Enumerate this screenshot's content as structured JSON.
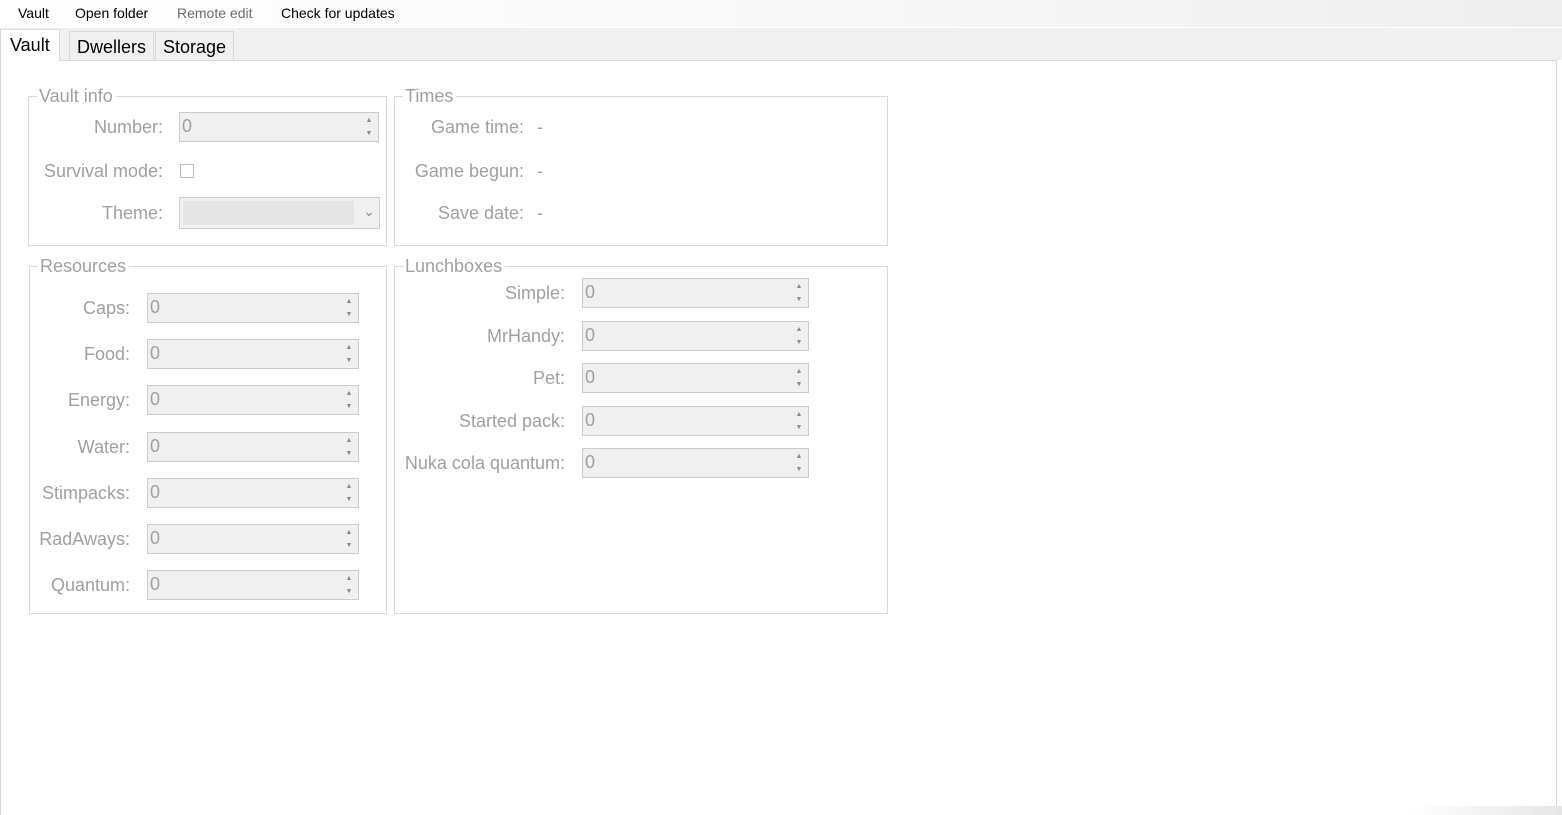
{
  "menu": {
    "items": [
      "Vault",
      "Open folder",
      "Remote edit",
      "Check for updates"
    ]
  },
  "tabs": [
    "Vault",
    "Dwellers",
    "Storage"
  ],
  "vault_info": {
    "title": "Vault info",
    "number_label": "Number:",
    "number_value": "0",
    "survival_label": "Survival mode:",
    "survival_checked": false,
    "theme_label": "Theme:",
    "theme_value": ""
  },
  "times": {
    "title": "Times",
    "game_time_label": "Game time:",
    "game_time_value": "-",
    "game_begun_label": "Game begun:",
    "game_begun_value": "-",
    "save_date_label": "Save date:",
    "save_date_value": "-"
  },
  "resources": {
    "title": "Resources",
    "fields": [
      {
        "label": "Caps:",
        "value": "0"
      },
      {
        "label": "Food:",
        "value": "0"
      },
      {
        "label": "Energy:",
        "value": "0"
      },
      {
        "label": "Water:",
        "value": "0"
      },
      {
        "label": "Stimpacks:",
        "value": "0"
      },
      {
        "label": "RadAways:",
        "value": "0"
      },
      {
        "label": "Quantum:",
        "value": "0"
      }
    ]
  },
  "lunchboxes": {
    "title": "Lunchboxes",
    "fields": [
      {
        "label": "Simple:",
        "value": "0"
      },
      {
        "label": "MrHandy:",
        "value": "0"
      },
      {
        "label": "Pet:",
        "value": "0"
      },
      {
        "label": "Started pack:",
        "value": "0"
      },
      {
        "label": "Nuka cola quantum:",
        "value": "0"
      }
    ]
  },
  "colors": {
    "disabled_text": "#a0a0a0",
    "group_border": "#d9d9d9",
    "field_background": "#f0f0f0"
  },
  "icons": {
    "spin_up": "spin-up-arrow-icon",
    "spin_down": "spin-down-arrow-icon",
    "combo_arrow": "chevron-down-icon"
  }
}
